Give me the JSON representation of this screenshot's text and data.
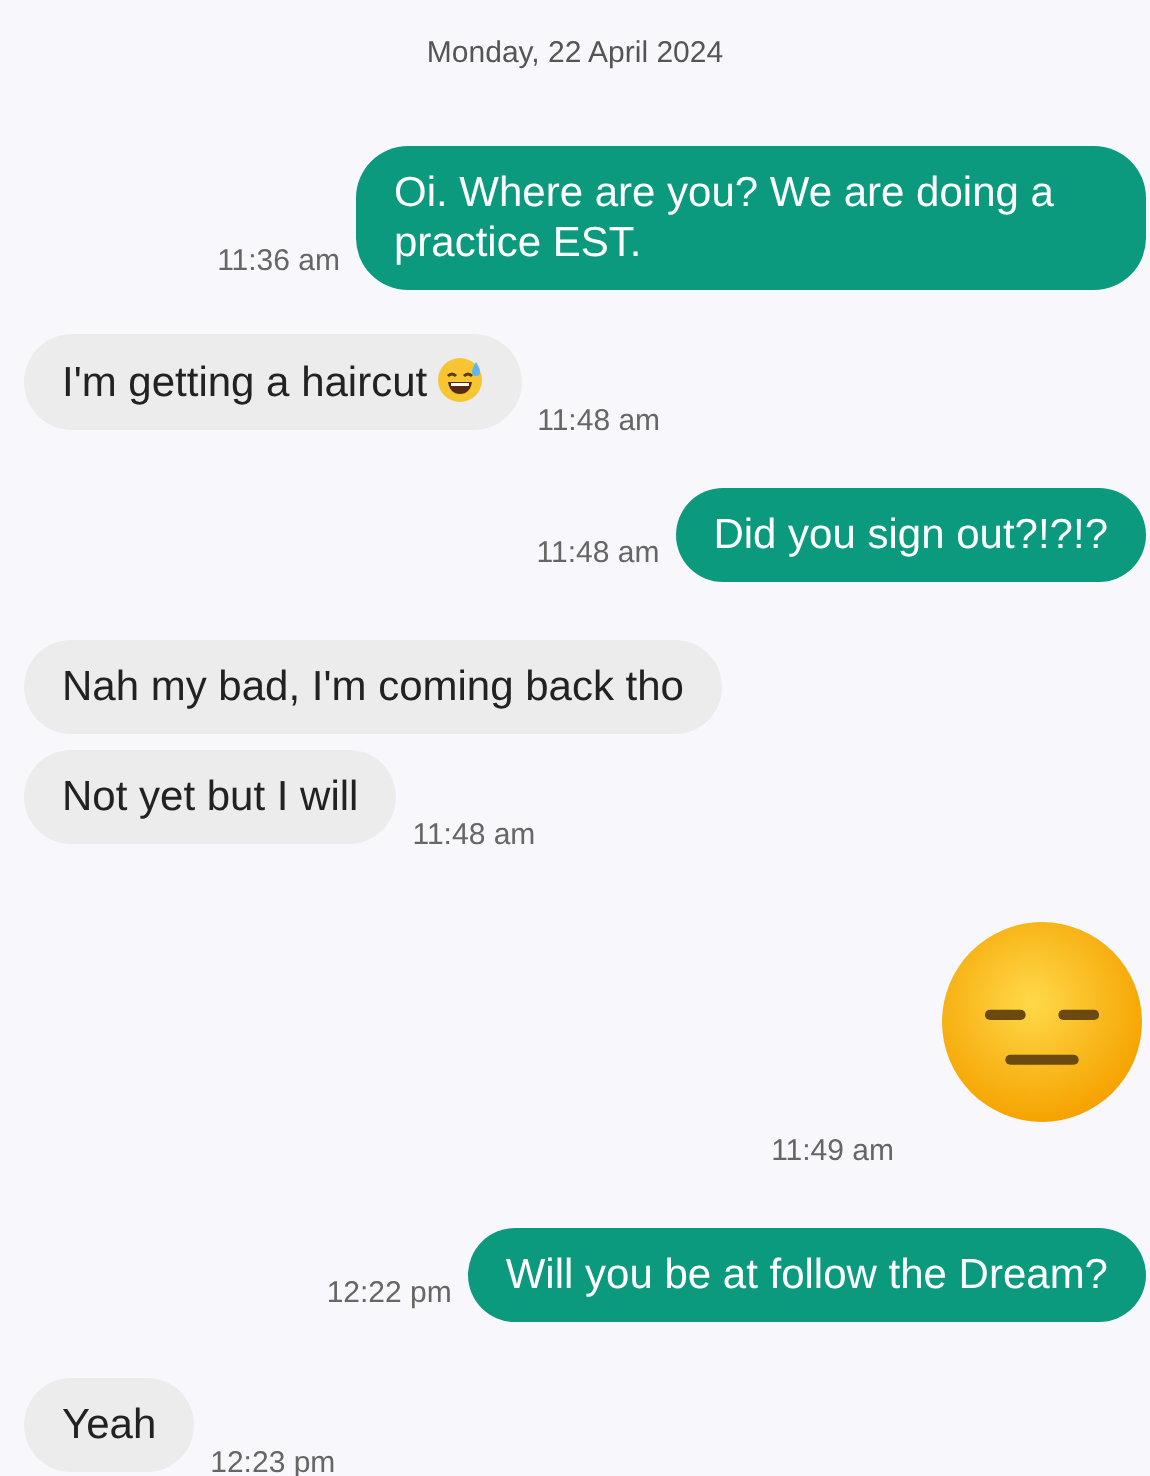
{
  "date_header": "Monday, 22 April 2024",
  "messages": [
    {
      "kind": "text",
      "outgoing": true,
      "text": "Oi. Where are you? We are doing a practice EST.",
      "time": "11:36 am"
    },
    {
      "kind": "text_emoji",
      "outgoing": false,
      "text": "I'm getting a haircut",
      "time": "11:48 am"
    },
    {
      "kind": "text",
      "outgoing": true,
      "text": "Did you sign out?!?!?",
      "time": "11:48 am"
    },
    {
      "kind": "text",
      "outgoing": false,
      "text": "Nah my bad, I'm coming back tho"
    },
    {
      "kind": "text",
      "outgoing": false,
      "text": "Not yet but I will",
      "time": "11:48 am"
    },
    {
      "kind": "emoji",
      "outgoing": true,
      "time": "11:49 am"
    },
    {
      "kind": "text",
      "outgoing": true,
      "text": "Will you be at follow the Dream?",
      "time": "12:22 pm"
    },
    {
      "kind": "text",
      "outgoing": false,
      "text": "Yeah",
      "time": "12:23 pm"
    }
  ]
}
